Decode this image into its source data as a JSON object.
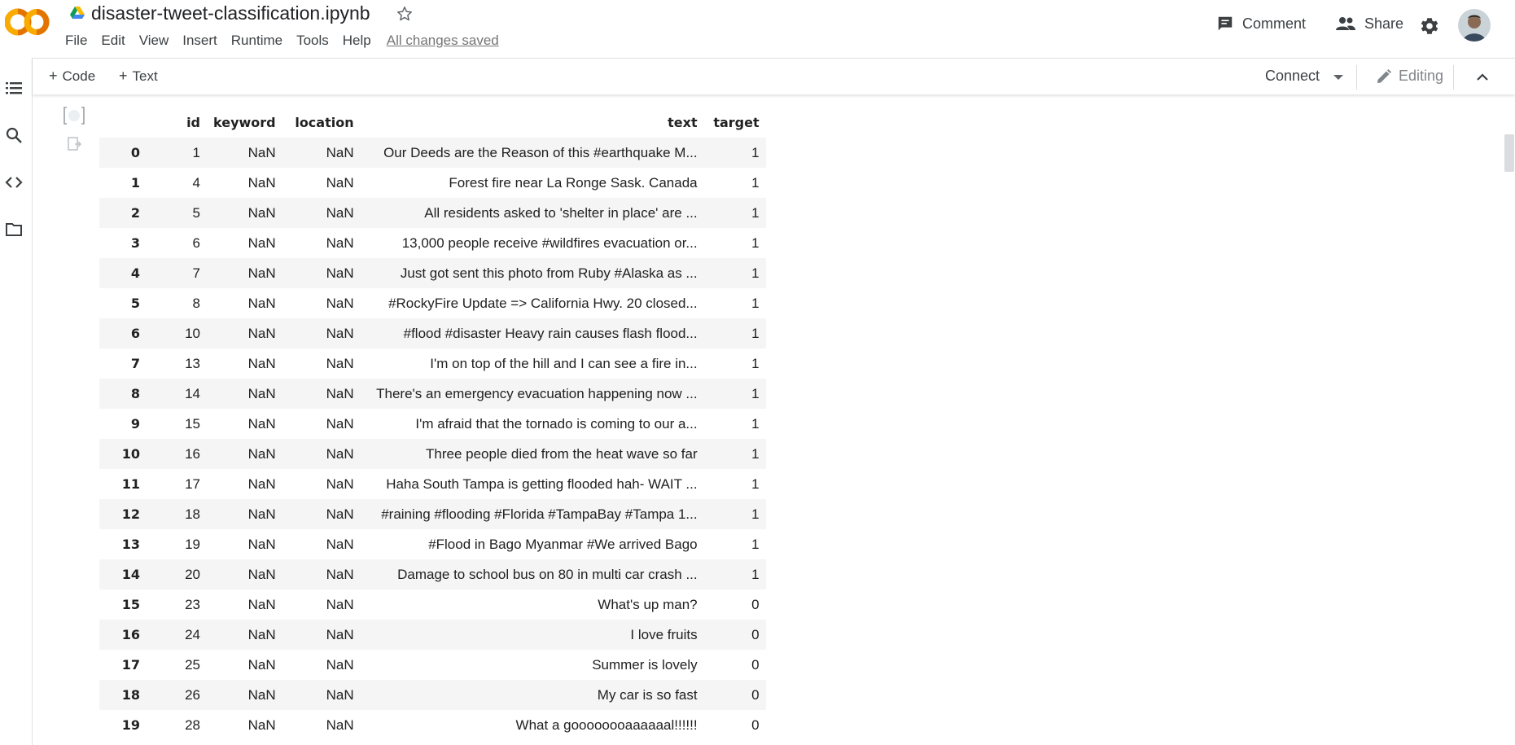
{
  "header": {
    "title": "disaster-tweet-classification.ipynb",
    "menu": [
      "File",
      "Edit",
      "View",
      "Insert",
      "Runtime",
      "Tools",
      "Help"
    ],
    "saved_status": "All changes saved",
    "comment_label": "Comment",
    "share_label": "Share",
    "logo_text": "CO"
  },
  "toolbar": {
    "code_label": "Code",
    "text_label": "Text",
    "connect_label": "Connect",
    "editing_label": "Editing"
  },
  "icons": {
    "rail": [
      "table-of-contents-icon",
      "search-icon",
      "code-snippets-icon",
      "files-icon"
    ]
  },
  "colors": {
    "logo_orange": "#f9ab00",
    "logo_orange_dark": "#e37400",
    "drive_blue": "#4285f4"
  },
  "dataframe": {
    "columns": [
      "id",
      "keyword",
      "location",
      "text",
      "target"
    ],
    "rows": [
      {
        "index": "0",
        "id": "1",
        "keyword": "NaN",
        "location": "NaN",
        "text": "Our Deeds are the Reason of this #earthquake M...",
        "target": "1"
      },
      {
        "index": "1",
        "id": "4",
        "keyword": "NaN",
        "location": "NaN",
        "text": "Forest fire near La Ronge Sask. Canada",
        "target": "1"
      },
      {
        "index": "2",
        "id": "5",
        "keyword": "NaN",
        "location": "NaN",
        "text": "All residents asked to 'shelter in place' are ...",
        "target": "1"
      },
      {
        "index": "3",
        "id": "6",
        "keyword": "NaN",
        "location": "NaN",
        "text": "13,000 people receive #wildfires evacuation or...",
        "target": "1"
      },
      {
        "index": "4",
        "id": "7",
        "keyword": "NaN",
        "location": "NaN",
        "text": "Just got sent this photo from Ruby #Alaska as ...",
        "target": "1"
      },
      {
        "index": "5",
        "id": "8",
        "keyword": "NaN",
        "location": "NaN",
        "text": "#RockyFire Update => California Hwy. 20 closed...",
        "target": "1"
      },
      {
        "index": "6",
        "id": "10",
        "keyword": "NaN",
        "location": "NaN",
        "text": "#flood #disaster Heavy rain causes flash flood...",
        "target": "1"
      },
      {
        "index": "7",
        "id": "13",
        "keyword": "NaN",
        "location": "NaN",
        "text": "I'm on top of the hill and I can see a fire in...",
        "target": "1"
      },
      {
        "index": "8",
        "id": "14",
        "keyword": "NaN",
        "location": "NaN",
        "text": "There's an emergency evacuation happening now ...",
        "target": "1"
      },
      {
        "index": "9",
        "id": "15",
        "keyword": "NaN",
        "location": "NaN",
        "text": "I'm afraid that the tornado is coming to our a...",
        "target": "1"
      },
      {
        "index": "10",
        "id": "16",
        "keyword": "NaN",
        "location": "NaN",
        "text": "Three people died from the heat wave so far",
        "target": "1"
      },
      {
        "index": "11",
        "id": "17",
        "keyword": "NaN",
        "location": "NaN",
        "text": "Haha South Tampa is getting flooded hah- WAIT ...",
        "target": "1"
      },
      {
        "index": "12",
        "id": "18",
        "keyword": "NaN",
        "location": "NaN",
        "text": "#raining #flooding #Florida #TampaBay #Tampa 1...",
        "target": "1"
      },
      {
        "index": "13",
        "id": "19",
        "keyword": "NaN",
        "location": "NaN",
        "text": "#Flood in Bago Myanmar #We arrived Bago",
        "target": "1"
      },
      {
        "index": "14",
        "id": "20",
        "keyword": "NaN",
        "location": "NaN",
        "text": "Damage to school bus on 80 in multi car crash ...",
        "target": "1"
      },
      {
        "index": "15",
        "id": "23",
        "keyword": "NaN",
        "location": "NaN",
        "text": "What's up man?",
        "target": "0"
      },
      {
        "index": "16",
        "id": "24",
        "keyword": "NaN",
        "location": "NaN",
        "text": "I love fruits",
        "target": "0"
      },
      {
        "index": "17",
        "id": "25",
        "keyword": "NaN",
        "location": "NaN",
        "text": "Summer is lovely",
        "target": "0"
      },
      {
        "index": "18",
        "id": "26",
        "keyword": "NaN",
        "location": "NaN",
        "text": "My car is so fast",
        "target": "0"
      },
      {
        "index": "19",
        "id": "28",
        "keyword": "NaN",
        "location": "NaN",
        "text": "What a goooooooaaaaaal!!!!!!",
        "target": "0"
      }
    ]
  }
}
